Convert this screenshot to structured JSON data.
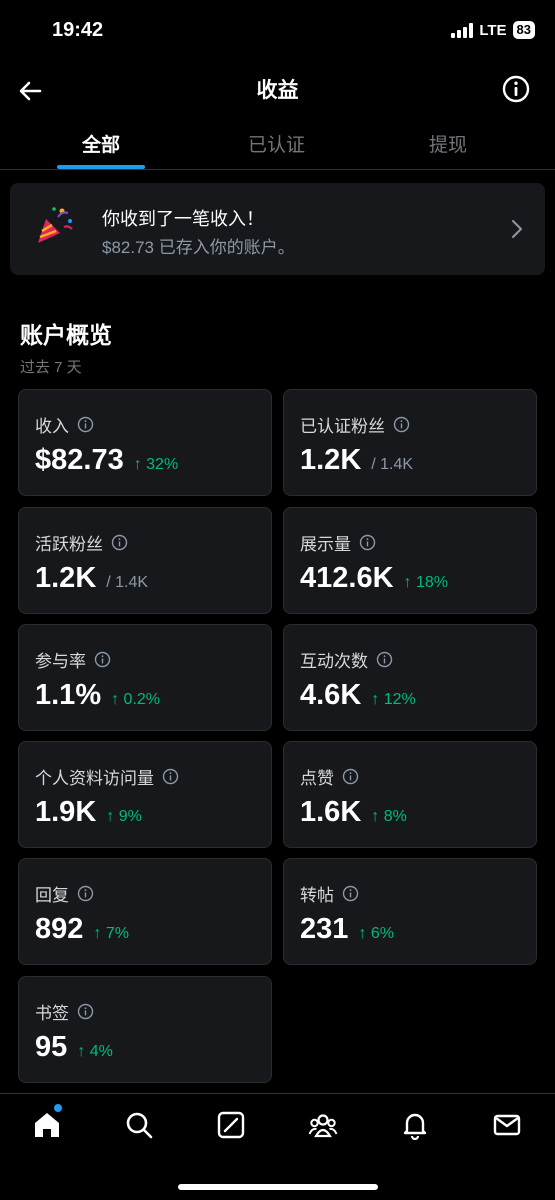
{
  "status": {
    "time": "19:42",
    "network": "LTE",
    "battery": "83"
  },
  "header": {
    "title": "收益",
    "back_icon": "arrow-left-icon",
    "info_icon": "info-circle-icon"
  },
  "tabs": [
    {
      "label": "全部",
      "active": true
    },
    {
      "label": "已认证",
      "active": false
    },
    {
      "label": "提现",
      "active": false
    }
  ],
  "notice": {
    "title": "你收到了一笔收入！",
    "subtitle": "$82.73 已存入你的账户。",
    "icon": "party-popper-icon"
  },
  "overview": {
    "title": "账户概览",
    "period": "过去 7 天",
    "cards": [
      {
        "label": "收入",
        "value": "$82.73",
        "change": "↑ 32%"
      },
      {
        "label": "已认证粉丝",
        "value": "1.2K",
        "total": "/ 1.4K"
      },
      {
        "label": "活跃粉丝",
        "value": "1.2K",
        "total": "/ 1.4K"
      },
      {
        "label": "展示量",
        "value": "412.6K",
        "change": "↑ 18%"
      },
      {
        "label": "参与率",
        "value": "1.1%",
        "change": "↑ 0.2%"
      },
      {
        "label": "互动次数",
        "value": "4.6K",
        "change": "↑ 12%"
      },
      {
        "label": "个人资料访问量",
        "value": "1.9K",
        "change": "↑ 9%"
      },
      {
        "label": "点赞",
        "value": "1.6K",
        "change": "↑ 8%"
      },
      {
        "label": "回复",
        "value": "892",
        "change": "↑ 7%"
      },
      {
        "label": "转帖",
        "value": "231",
        "change": "↑ 6%"
      },
      {
        "label": "书签",
        "value": "95",
        "change": "↑ 4%"
      }
    ]
  },
  "bottom_nav": [
    "home-icon",
    "search-icon",
    "grok-icon",
    "communities-icon",
    "notifications-icon",
    "messages-icon"
  ],
  "colors": {
    "accent": "#1d9bf0",
    "positive": "#00ba7c",
    "card_bg": "#16181c"
  }
}
